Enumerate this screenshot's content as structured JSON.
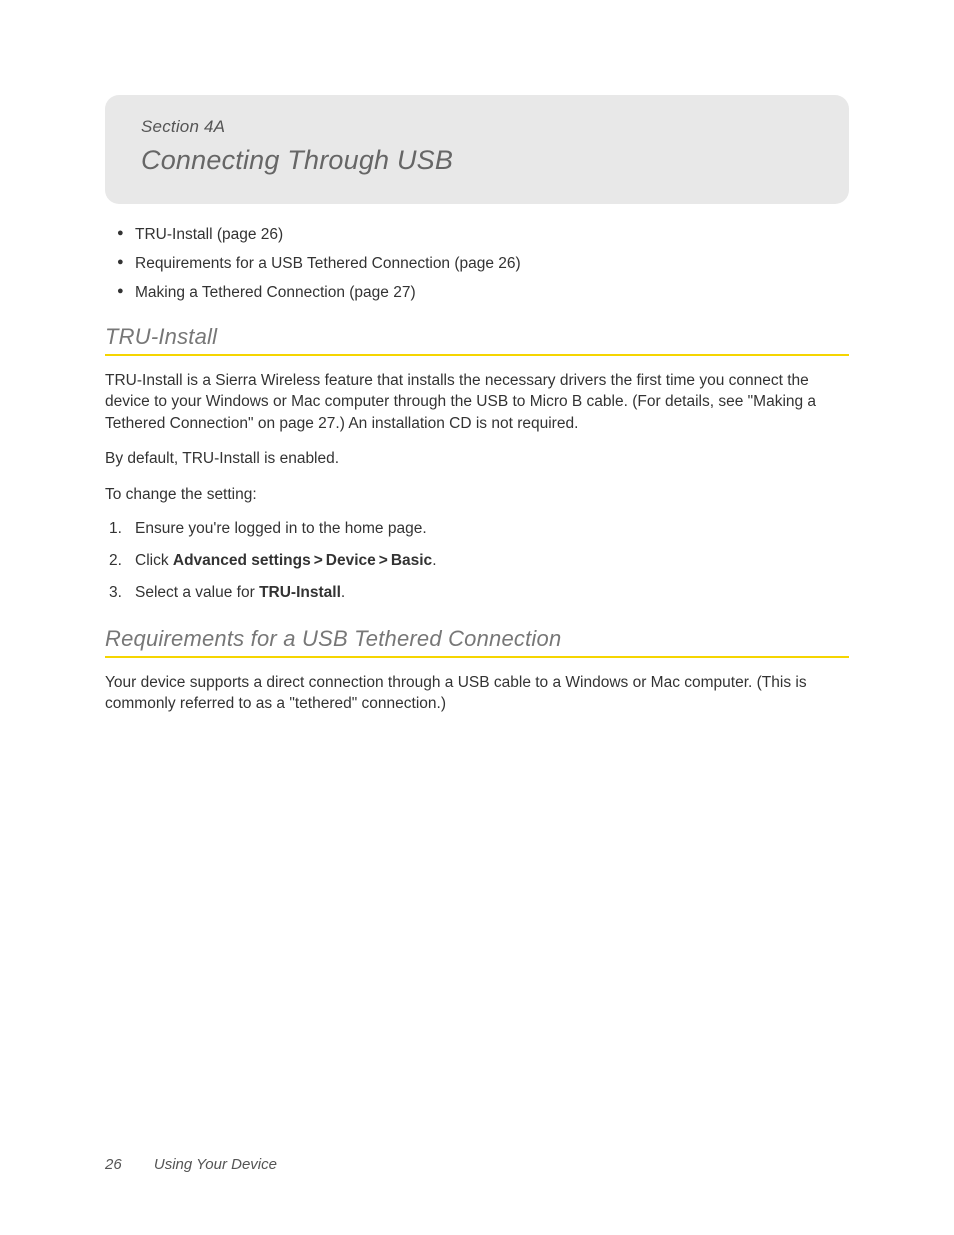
{
  "header": {
    "sectionLabel": "Section 4A",
    "title": "Connecting Through USB"
  },
  "toc": {
    "items": [
      "TRU-Install (page 26)",
      "Requirements for a USB Tethered Connection (page 26)",
      "Making a Tethered Connection (page 27)"
    ]
  },
  "truInstall": {
    "heading": "TRU-Install",
    "para1": "TRU-Install is a Sierra Wireless feature that installs the necessary drivers the first time you connect the device to your Windows or Mac computer through the USB to Micro B cable. (For details, see \"Making a Tethered Connection\" on page 27.) An installation CD is not required.",
    "para2": "By default, TRU-Install is enabled.",
    "para3": "To change the setting:",
    "step1": "Ensure you're logged in to the home page.",
    "step2_prefix": "Click ",
    "step2_b1": "Advanced settings",
    "step2_gt1": ">",
    "step2_b2": "Device",
    "step2_gt2": ">",
    "step2_b3": "Basic",
    "step2_suffix": ".",
    "step3_prefix": "Select a value for ",
    "step3_bold": "TRU-Install",
    "step3_suffix": "."
  },
  "requirements": {
    "heading": "Requirements for a USB Tethered Connection",
    "para1": "Your device supports a direct connection through a USB cable to a Windows or Mac computer. (This is commonly referred to as a \"tethered\" connection.)"
  },
  "footer": {
    "pageNumber": "26",
    "chapterTitle": "Using Your Device"
  }
}
